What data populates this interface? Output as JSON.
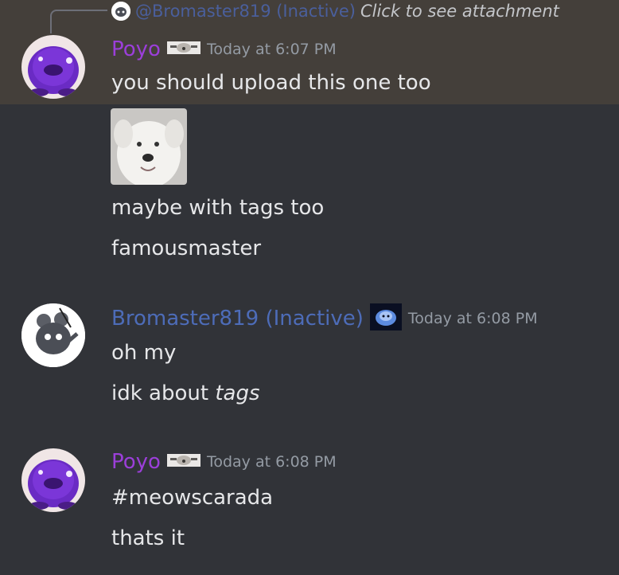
{
  "reply": {
    "mention": "@Bromaster819 (Inactive)",
    "link_text": "Click to see attachment"
  },
  "messages": [
    {
      "author": "Poyo",
      "timestamp": "Today at 6:07 PM",
      "lines": [
        "you should upload this one too",
        "maybe with tags too",
        "famousmaster"
      ],
      "has_attachment": true
    },
    {
      "author": "Bromaster819 (Inactive)",
      "timestamp": "Today at 6:08 PM",
      "lines": [
        "oh my"
      ],
      "line_prefix": "idk about ",
      "line_emphasis": "tags"
    },
    {
      "author": "Poyo",
      "timestamp": "Today at 6:08 PM",
      "lines": [
        "#meowscarada",
        "thats it"
      ]
    }
  ],
  "colors": {
    "background": "#313338",
    "highlight": "#443f3a",
    "poyo_name": "#9b3fd9",
    "bromaster_name": "#4d6cb8",
    "timestamp": "#949ba4",
    "text": "#e6e7e9"
  },
  "icons": {
    "poyo_avatar": "purple-round-creature-avatar",
    "bromaster_avatar": "grey-mouse-creature-avatar",
    "poyo_badge": "dog-face-badge-icon",
    "bromaster_badge": "blue-ghost-badge-icon",
    "attachment": "white-dog-photo"
  }
}
